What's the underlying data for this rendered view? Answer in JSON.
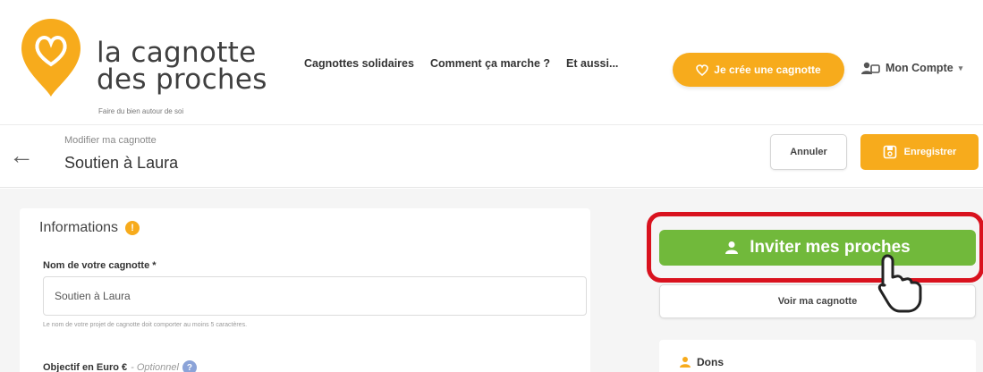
{
  "header": {
    "logo_line1": "la cagnotte",
    "logo_line2": "des proches",
    "tagline": "Faire du bien autour de soi",
    "nav": [
      "Cagnottes solidaires",
      "Comment ça marche ?",
      "Et aussi..."
    ],
    "cta_label": "Je crée une cagnotte",
    "account_label": "Mon Compte"
  },
  "subheader": {
    "label": "Modifier ma cagnotte",
    "title": "Soutien à Laura",
    "cancel_label": "Annuler",
    "save_label": "Enregistrer"
  },
  "form": {
    "section_title": "Informations",
    "name_label": "Nom de votre cagnotte *",
    "name_value": "Soutien à Laura",
    "name_help": "Le nom de votre projet de cagnotte doit comporter au moins 5 caractères.",
    "goal_label": "Objectif en Euro €",
    "goal_optional": "- Optionnel"
  },
  "side": {
    "invite_label": "Inviter mes proches",
    "view_label": "Voir ma cagnotte",
    "dons_label": "Dons"
  },
  "colors": {
    "accent": "#f7ab1c",
    "invite_green": "#71b93b",
    "highlight_red": "#d9121e"
  },
  "icons": {
    "logo": "heart-pin-icon",
    "cta": "heart-icon",
    "account": "users-icon",
    "back": "arrow-left-icon",
    "save": "save-icon",
    "invite": "user-icon",
    "cursor": "pointer-cursor-icon"
  }
}
